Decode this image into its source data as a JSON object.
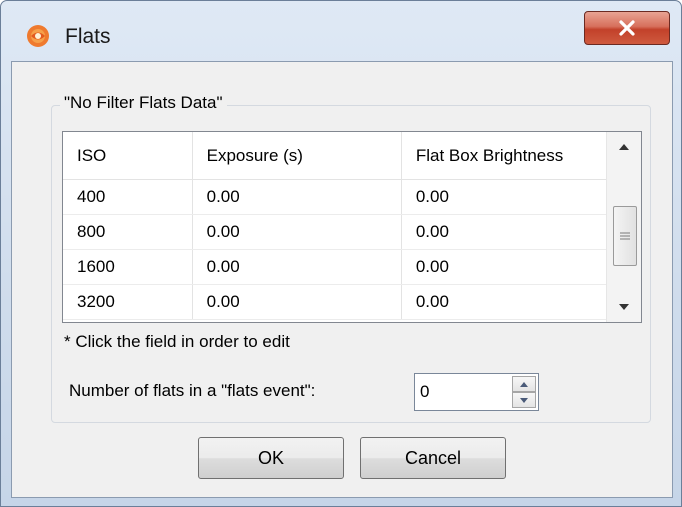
{
  "window": {
    "title": "Flats",
    "close_symbol": "X"
  },
  "group": {
    "label": "\"No Filter Flats Data\""
  },
  "table": {
    "columns": [
      "ISO",
      "Exposure (s)",
      "Flat Box Brightness"
    ],
    "rows": [
      [
        "400",
        "0.00",
        "0.00"
      ],
      [
        "800",
        "0.00",
        "0.00"
      ],
      [
        "1600",
        "0.00",
        "0.00"
      ],
      [
        "3200",
        "0.00",
        "0.00"
      ]
    ]
  },
  "hint": "* Click the field in order to edit",
  "flats": {
    "label": "Number of flats in a \"flats event\":",
    "value": "0"
  },
  "buttons": {
    "ok": "OK",
    "cancel": "Cancel"
  },
  "icons": {
    "app": "app-icon",
    "close": "close-icon",
    "scroll_up": "chevron-up-icon",
    "scroll_down": "chevron-down-icon",
    "spin_up": "spin-up-icon",
    "spin_down": "spin-down-icon"
  }
}
